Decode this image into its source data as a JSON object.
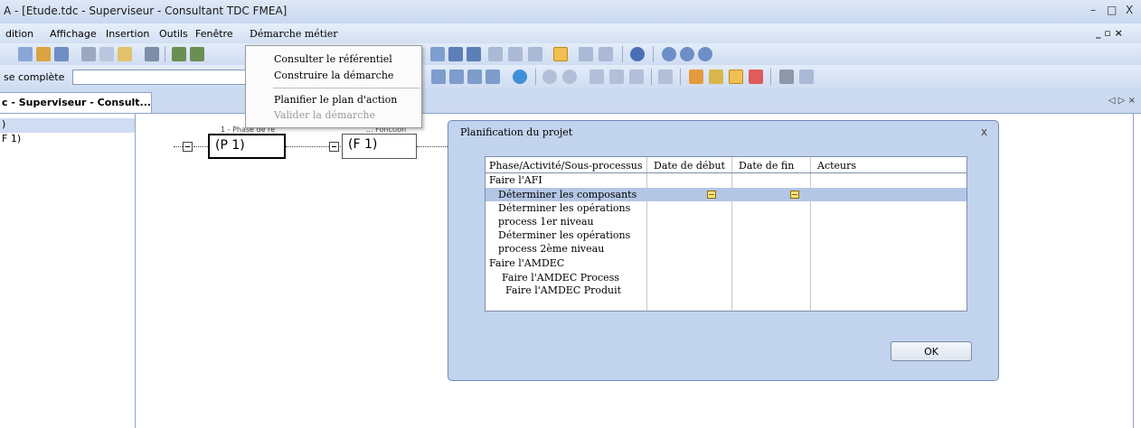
{
  "window": {
    "title": "A - [Etude.tdc - Superviseur - Consultant TDC FMEA]",
    "minimize": "–",
    "restore": "□",
    "close": "X"
  },
  "menubar": {
    "items": [
      "dition",
      "Affichage",
      "Insertion",
      "Outils",
      "Fenêtre",
      "Démarche métier"
    ],
    "mdi_controls": "_ ▫ ×"
  },
  "search": {
    "label": "se complète",
    "value": ""
  },
  "doc_tab": {
    "label": "c - Superviseur - Consult...",
    "nav": "◁ ▷ ×"
  },
  "tree": {
    "items": [
      ")",
      "F 1)"
    ]
  },
  "diagram": {
    "phase_header": "1 - Phase de ré",
    "phase_box": "(P 1)",
    "function_header": "... Fonction",
    "function_box": "(F 1)"
  },
  "dropdown": {
    "items": [
      {
        "label": "Consulter le référentiel",
        "enabled": true
      },
      {
        "label": "Construire la démarche",
        "enabled": true
      },
      {
        "label": "Planifier le plan d'action",
        "enabled": true
      },
      {
        "label": "Valider la démarche",
        "enabled": false
      }
    ]
  },
  "dialog": {
    "title": "Planification du projet",
    "close": "x",
    "columns": [
      "Phase/Activité/Sous-processus",
      "Date de début",
      "Date de fin",
      "Acteurs"
    ],
    "rows": [
      {
        "label": "Faire l'AFI",
        "level": 0
      },
      {
        "label": "Déterminer les composants",
        "level": 1,
        "selected": true
      },
      {
        "label": "Déterminer les opérations",
        "level": 1
      },
      {
        "label": "process 1er niveau",
        "level": 1
      },
      {
        "label": "Déterminer les opérations",
        "level": 1
      },
      {
        "label": "process 2ème niveau",
        "level": 1
      },
      {
        "label": "Faire l'AMDEC",
        "level": 0
      },
      {
        "label": "Faire l'AMDEC Process",
        "level": 1
      },
      {
        "label": "Faire l'AMDEC Produit",
        "level": 1
      }
    ],
    "ok_label": "OK"
  }
}
